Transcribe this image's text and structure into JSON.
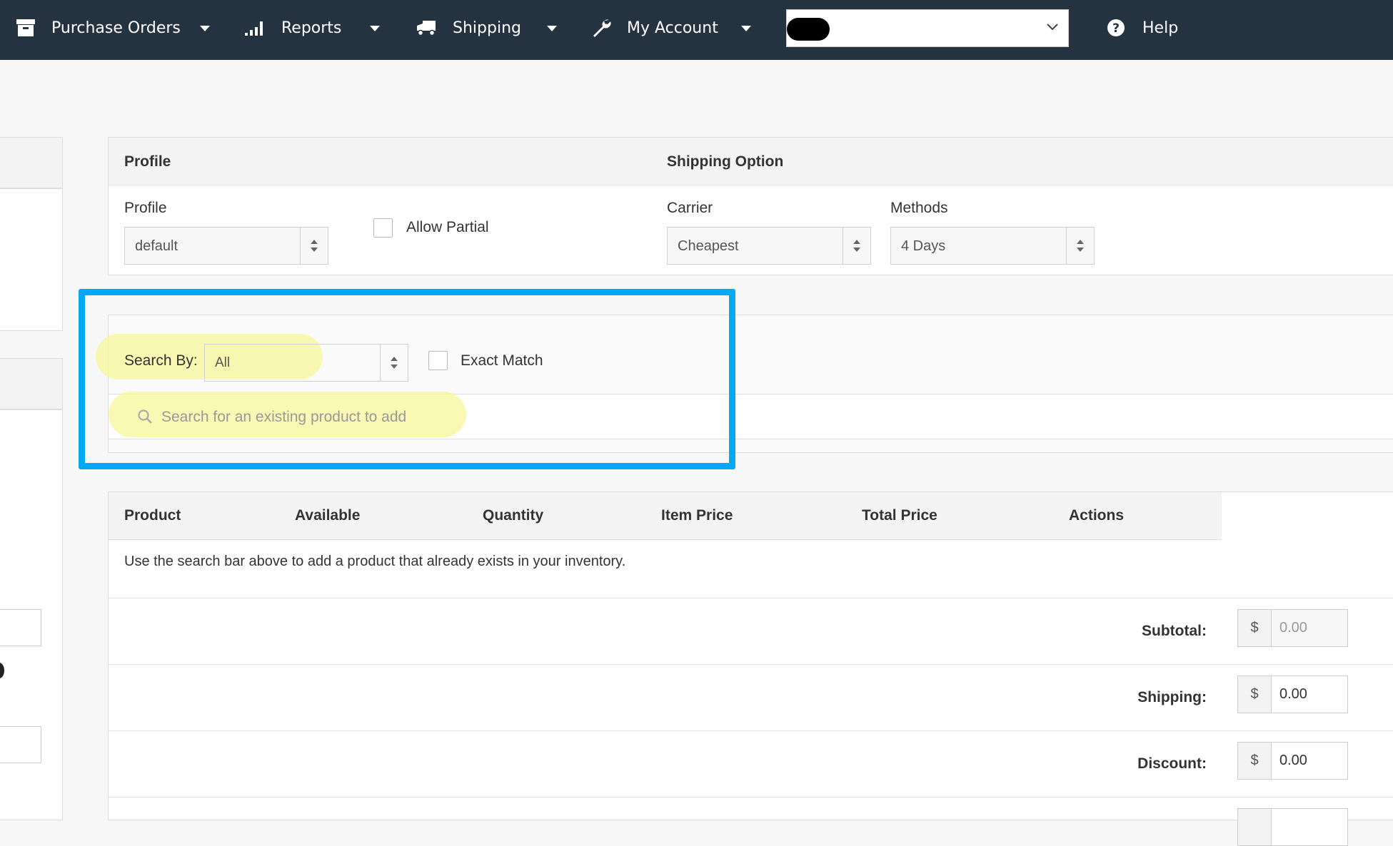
{
  "nav": {
    "purchase_orders": "Purchase Orders",
    "reports": "Reports",
    "shipping": "Shipping",
    "my_account": "My Account",
    "help": "Help"
  },
  "profile_section": {
    "profile_header": "Profile",
    "shipping_header": "Shipping Option",
    "profile_label": "Profile",
    "profile_value": "default",
    "allow_partial": "Allow Partial",
    "carrier_label": "Carrier",
    "carrier_value": "Cheapest",
    "methods_label": "Methods",
    "methods_value": "4 Days"
  },
  "search": {
    "search_by_label": "Search By:",
    "search_by_value": "All",
    "exact_match": "Exact Match",
    "placeholder": "Search for an existing product to add"
  },
  "table": {
    "headers": [
      "Product",
      "Available",
      "Quantity",
      "Item Price",
      "Total Price",
      "Actions"
    ],
    "empty_message": "Use the search bar above to add a product that already exists in your inventory."
  },
  "totals": [
    {
      "label": "Subtotal:",
      "currency": "$",
      "value": "0.00",
      "readonly": true
    },
    {
      "label": "Shipping:",
      "currency": "$",
      "value": "0.00",
      "readonly": false
    },
    {
      "label": "Discount:",
      "currency": "$",
      "value": "0.00",
      "readonly": false
    }
  ],
  "colors": {
    "topbar": "#253240",
    "highlight_box": "#03a9f4",
    "highlight_marker": "#f7f79a"
  }
}
